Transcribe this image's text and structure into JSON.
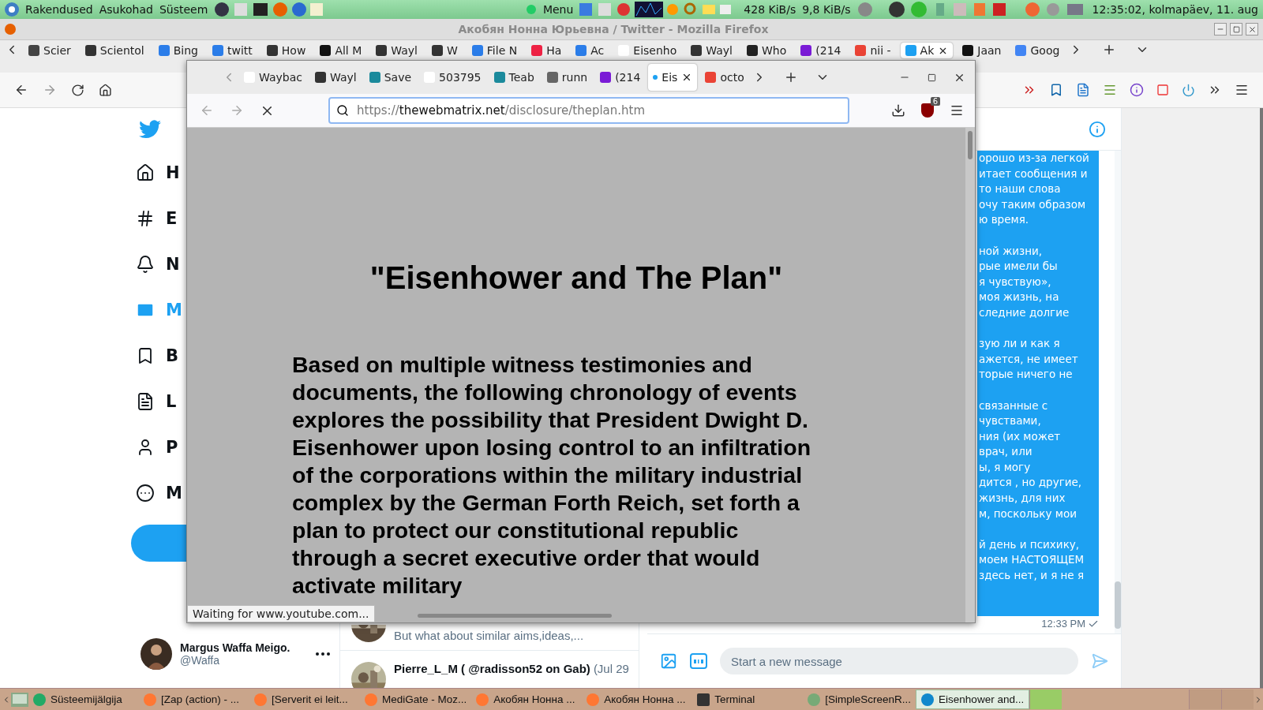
{
  "top_panel": {
    "menus": [
      "Rakendused",
      "Asukohad",
      "Süsteem"
    ],
    "menu_button": "Menu",
    "download_rate": "428 KiB/s",
    "upload_rate": "9,8 KiB/s",
    "clock": "12:35:02, kolmapäev, 11. aug"
  },
  "background_window": {
    "title": "Акобян Нонна Юрьевна / Twitter - Mozilla Firefox",
    "tabs": [
      {
        "label": "Scier",
        "selected": false
      },
      {
        "label": "Scientol",
        "selected": false
      },
      {
        "label": "Bing",
        "selected": false
      },
      {
        "label": "twitt",
        "selected": false
      },
      {
        "label": "How",
        "selected": false
      },
      {
        "label": "All M",
        "selected": false
      },
      {
        "label": "Wayl",
        "selected": false
      },
      {
        "label": "W",
        "selected": false
      },
      {
        "label": "File N",
        "selected": false
      },
      {
        "label": "Ha",
        "selected": false
      },
      {
        "label": "Ac",
        "selected": false
      },
      {
        "label": "Eisenho",
        "selected": false
      },
      {
        "label": "Wayl",
        "selected": false
      },
      {
        "label": "Who",
        "selected": false
      },
      {
        "label": "(214",
        "selected": false
      },
      {
        "label": "nii -",
        "selected": false
      },
      {
        "label": "Ak",
        "selected": true
      },
      {
        "label": "Jaan",
        "selected": false
      },
      {
        "label": "Goog",
        "selected": false
      }
    ],
    "sidebar": {
      "items": [
        {
          "label": "H",
          "selected": false
        },
        {
          "label": "E",
          "selected": false
        },
        {
          "label": "N",
          "selected": false
        },
        {
          "label": "M",
          "selected": true
        },
        {
          "label": "B",
          "selected": false
        },
        {
          "label": "L",
          "selected": false
        },
        {
          "label": "P",
          "selected": false
        },
        {
          "label": "M",
          "selected": false
        }
      ],
      "profile": {
        "name": "Margus Waffa Meigo.",
        "handle": "@Waffa"
      }
    },
    "feed": [
      {
        "text": "But what about similar aims,ideas,..."
      },
      {
        "author": "Pierre_L_M ( @radisson52 on Gab)",
        "date": "(Jul 29"
      }
    ],
    "conversation": {
      "paragraphs": [
        [
          "орошо из-за легкой",
          "итает сообщения и",
          "то наши слова",
          "очу таким образом",
          "ю время."
        ],
        [
          "ной жизни,",
          "рые имели бы",
          "я чувствую»,",
          "моя жизнь, на",
          "следние долгие"
        ],
        [
          "зую ли и как я",
          "ажется, не имеет",
          "торые ничего не"
        ],
        [
          "связанные с",
          "чувствами,",
          "ния (их может",
          "врач, или",
          "ы, я могу",
          "дится , но другие,",
          "жизнь, для них",
          "м, поскольку мои"
        ],
        [
          "й день и психику,",
          "моем НАСТОЯЩЕМ",
          "здесь нет, и я не я"
        ]
      ],
      "time": "12:33 PM",
      "composer": {
        "placeholder": "Start a new message"
      }
    }
  },
  "popup_window": {
    "tabs": [
      {
        "label": "Waybac",
        "selected": false
      },
      {
        "label": "Wayl",
        "selected": false
      },
      {
        "label": "Save",
        "selected": false
      },
      {
        "label": "503795",
        "selected": false
      },
      {
        "label": "Teab",
        "selected": false
      },
      {
        "label": "runn",
        "selected": false
      },
      {
        "label": "(214",
        "selected": false
      },
      {
        "label": "Eis",
        "selected": true
      },
      {
        "label": "octo",
        "selected": false
      }
    ],
    "url": {
      "scheme": "https://",
      "host": "thewebmatrix.net",
      "path": "/disclosure/theplan.htm"
    },
    "blocker_count": "6",
    "page": {
      "title": "\"Eisenhower and The Plan\"",
      "paragraph": "Based on multiple witness testimonies and documents, the following chronology of events explores the possibility that President Dwight D. Eisenhower upon losing control to an infiltration of the corporations within the military industrial complex by the German Forth Reich, set forth a plan to protect our constitutional republic through a secret executive order that would activate military"
    },
    "status": "Waiting for www.youtube.com..."
  },
  "taskbar": {
    "items": [
      {
        "label": "Süsteemijälgija",
        "selected": false
      },
      {
        "label": "[Zap (action) - ...",
        "selected": false
      },
      {
        "label": "[Serverit ei leit...",
        "selected": false
      },
      {
        "label": "MediGate - Moz...",
        "selected": false
      },
      {
        "label": "Акобян Нонна ...",
        "selected": false
      },
      {
        "label": "Акобян Нонна ...",
        "selected": false
      },
      {
        "label": "Terminal",
        "selected": false
      },
      {
        "label": "[SimpleScreenR...",
        "selected": false
      },
      {
        "label": "Eisenhower and...",
        "selected": true
      }
    ]
  }
}
